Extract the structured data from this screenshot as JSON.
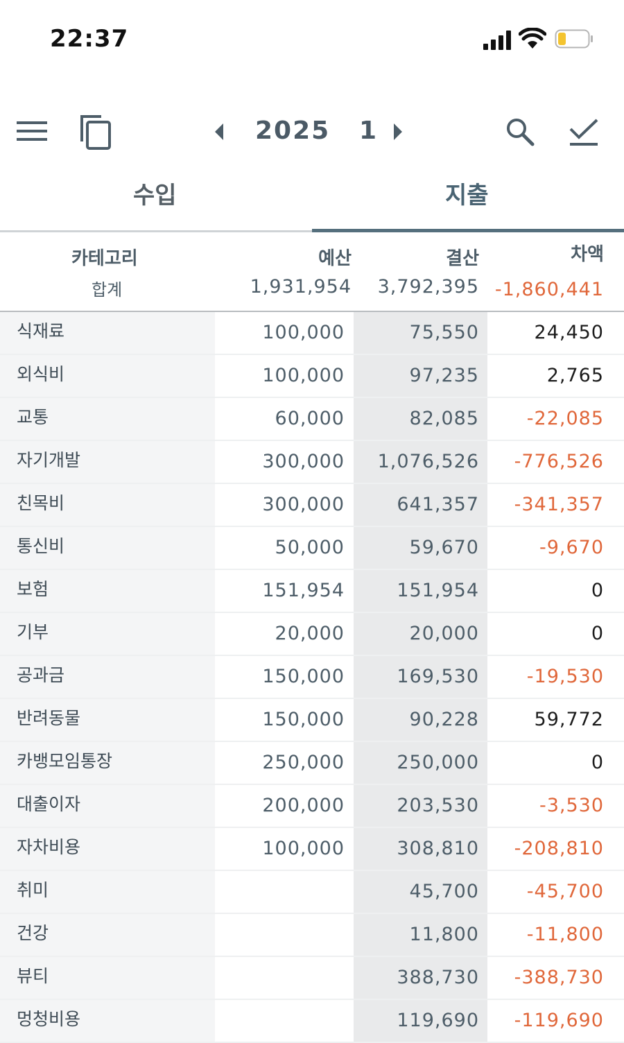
{
  "status_bar": {
    "time": "22:37"
  },
  "toolbar": {
    "year": "2025",
    "month": "1"
  },
  "tabs": [
    {
      "label": "수입",
      "active": false
    },
    {
      "label": "지출",
      "active": true
    }
  ],
  "header": {
    "category": "카테고리",
    "total_label": "합계",
    "budget": "예산",
    "actual": "결산",
    "difference": "차액",
    "total_budget": "1,931,954",
    "total_actual": "3,792,395",
    "total_difference": "-1,860,441"
  },
  "colors": {
    "negative": "#e0673a",
    "accent": "#556f7d"
  },
  "rows": [
    {
      "name": "식재료",
      "budget": "100,000",
      "actual": "75,550",
      "diff": "24,450",
      "negative": false
    },
    {
      "name": "외식비",
      "budget": "100,000",
      "actual": "97,235",
      "diff": "2,765",
      "negative": false
    },
    {
      "name": "교통",
      "budget": "60,000",
      "actual": "82,085",
      "diff": "-22,085",
      "negative": true
    },
    {
      "name": "자기개발",
      "budget": "300,000",
      "actual": "1,076,526",
      "diff": "-776,526",
      "negative": true
    },
    {
      "name": "친목비",
      "budget": "300,000",
      "actual": "641,357",
      "diff": "-341,357",
      "negative": true
    },
    {
      "name": "통신비",
      "budget": "50,000",
      "actual": "59,670",
      "diff": "-9,670",
      "negative": true
    },
    {
      "name": "보험",
      "budget": "151,954",
      "actual": "151,954",
      "diff": "0",
      "negative": false
    },
    {
      "name": "기부",
      "budget": "20,000",
      "actual": "20,000",
      "diff": "0",
      "negative": false
    },
    {
      "name": "공과금",
      "budget": "150,000",
      "actual": "169,530",
      "diff": "-19,530",
      "negative": true
    },
    {
      "name": "반려동물",
      "budget": "150,000",
      "actual": "90,228",
      "diff": "59,772",
      "negative": false
    },
    {
      "name": "카뱅모임통장",
      "budget": "250,000",
      "actual": "250,000",
      "diff": "0",
      "negative": false
    },
    {
      "name": "대출이자",
      "budget": "200,000",
      "actual": "203,530",
      "diff": "-3,530",
      "negative": true
    },
    {
      "name": "자차비용",
      "budget": "100,000",
      "actual": "308,810",
      "diff": "-208,810",
      "negative": true
    },
    {
      "name": "취미",
      "budget": "",
      "actual": "45,700",
      "diff": "-45,700",
      "negative": true
    },
    {
      "name": "건강",
      "budget": "",
      "actual": "11,800",
      "diff": "-11,800",
      "negative": true
    },
    {
      "name": "뷰티",
      "budget": "",
      "actual": "388,730",
      "diff": "-388,730",
      "negative": true
    },
    {
      "name": "멍청비용",
      "budget": "",
      "actual": "119,690",
      "diff": "-119,690",
      "negative": true
    }
  ]
}
